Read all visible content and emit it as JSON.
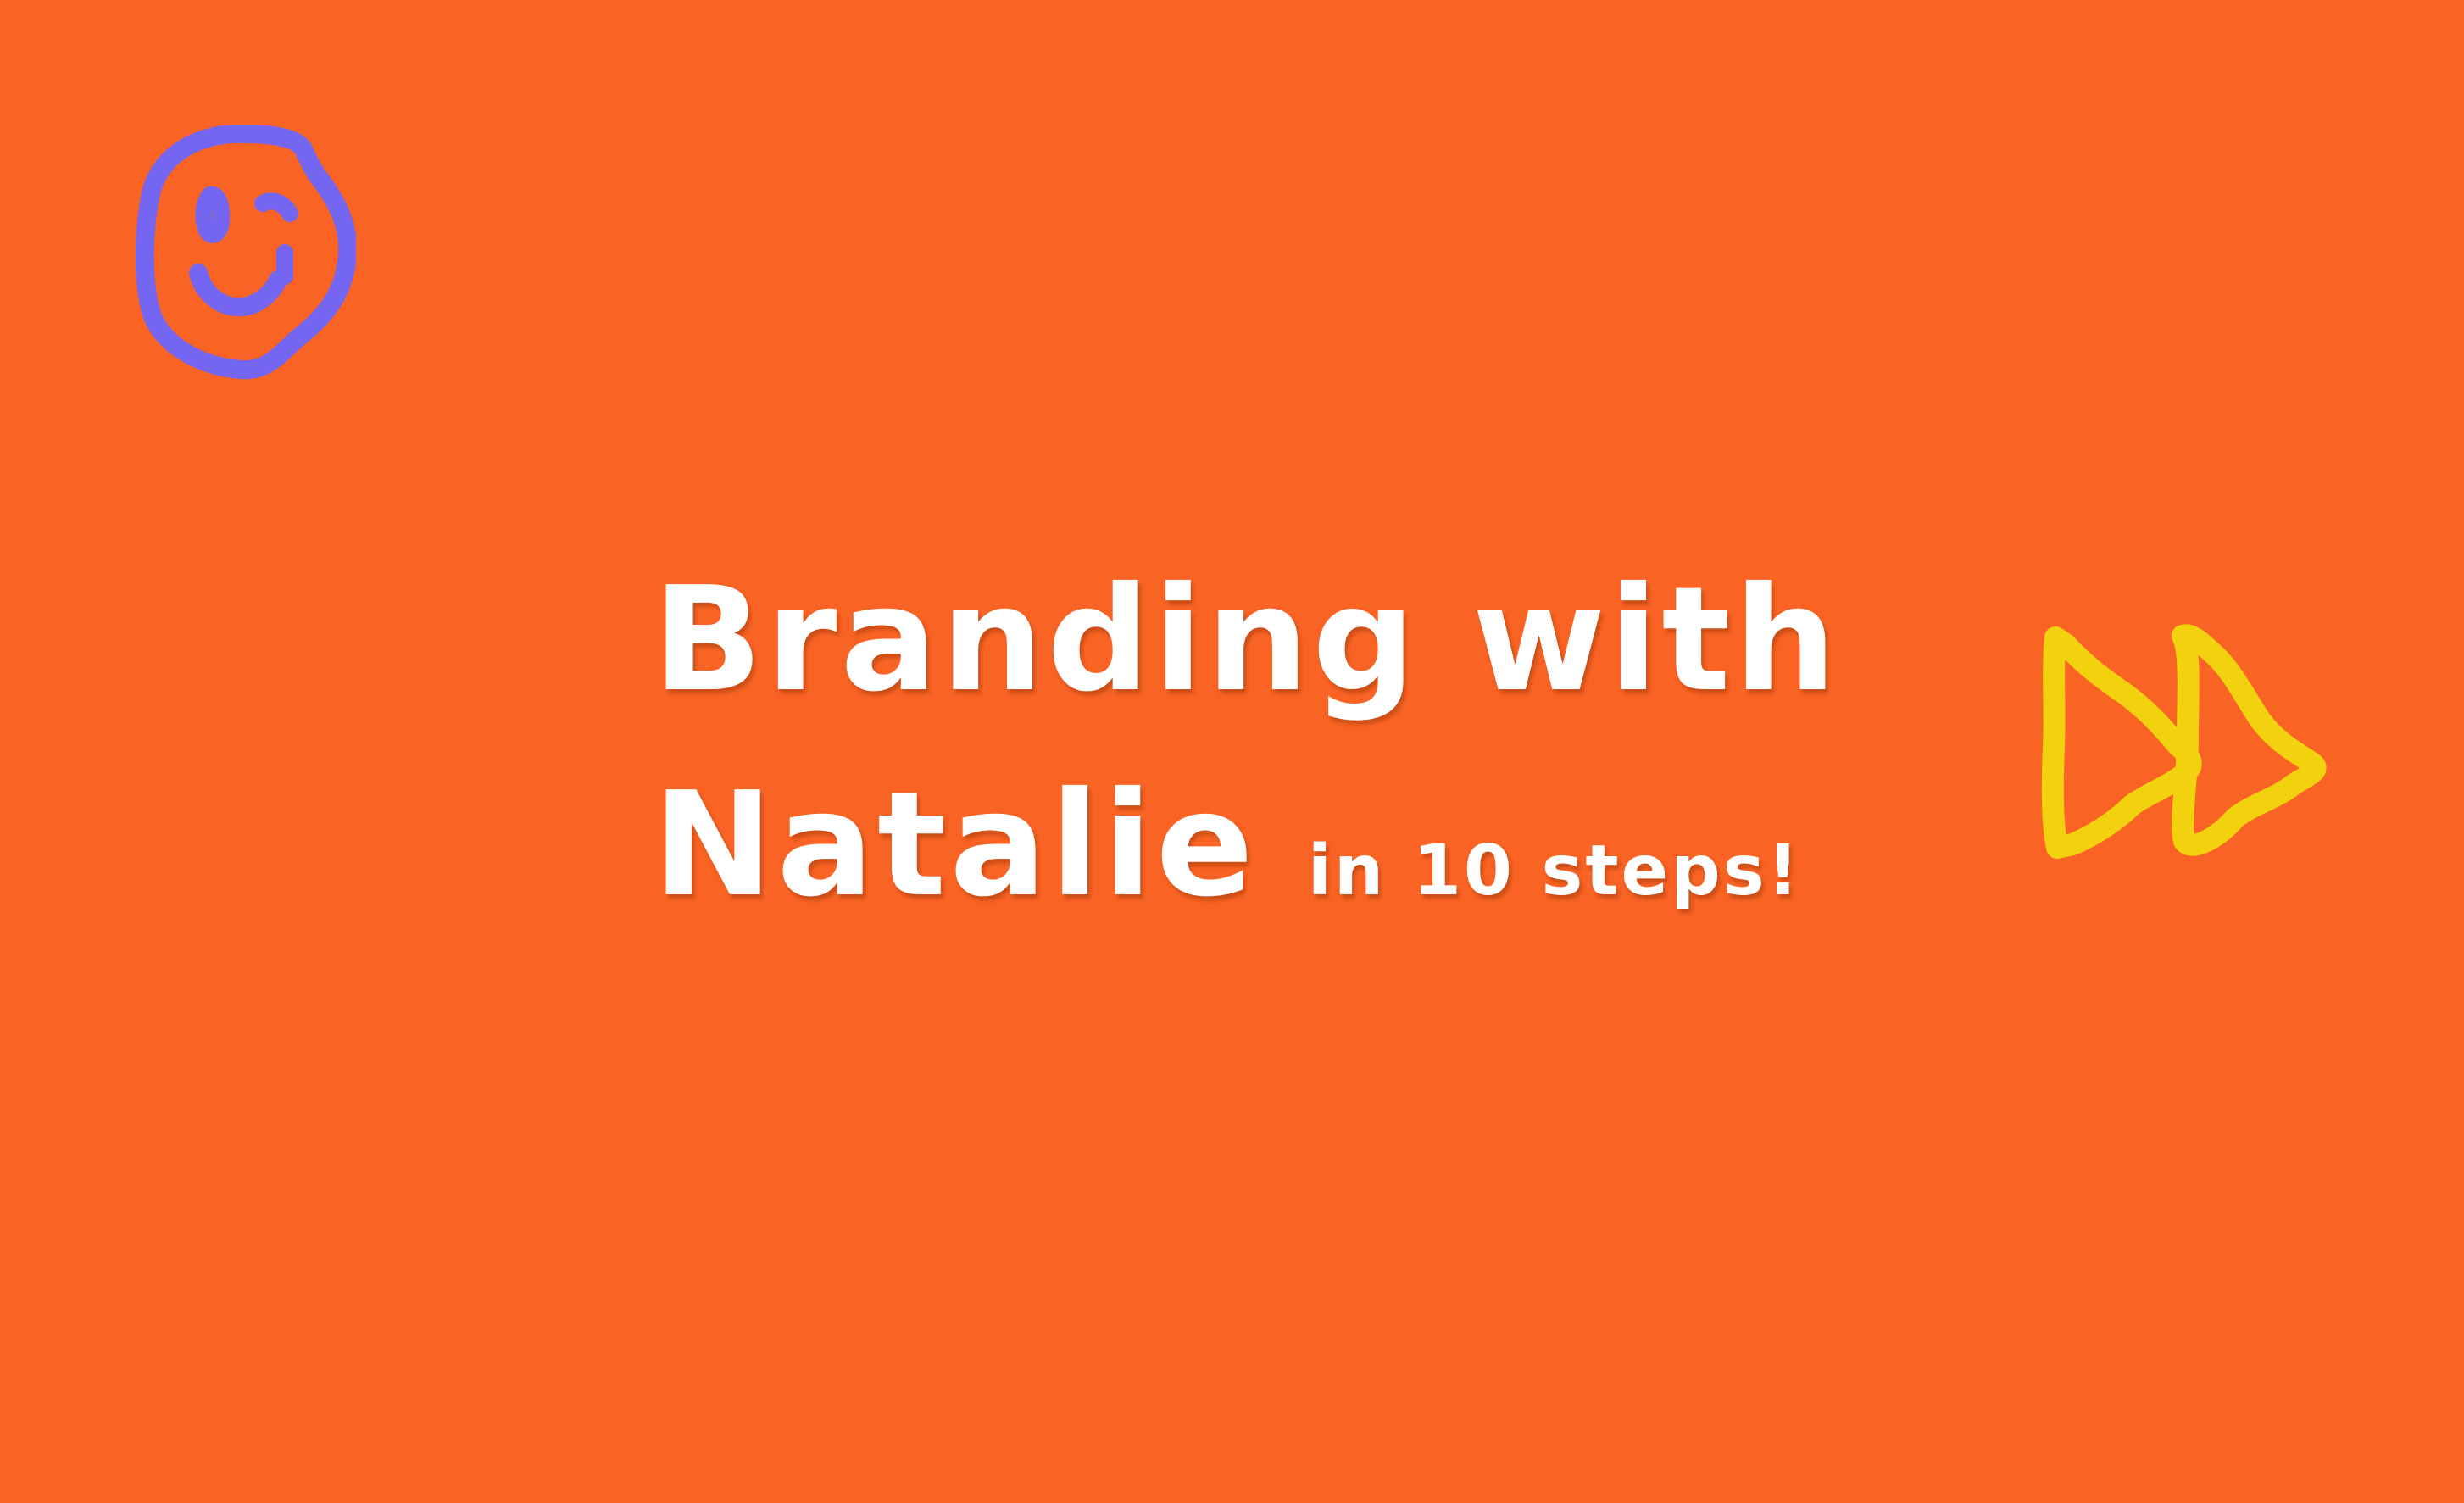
{
  "slide": {
    "title_line1": "Branding with",
    "title_line2": "Natalie",
    "subtitle": "in 10 steps!"
  },
  "icons": {
    "top_left": "smiley-face-icon",
    "right": "fast-forward-icon"
  },
  "colors": {
    "background": "#F96323",
    "text": "#FFFFFF",
    "smiley_stroke": "#7466F0",
    "arrow_stroke": "#F2D20F"
  }
}
